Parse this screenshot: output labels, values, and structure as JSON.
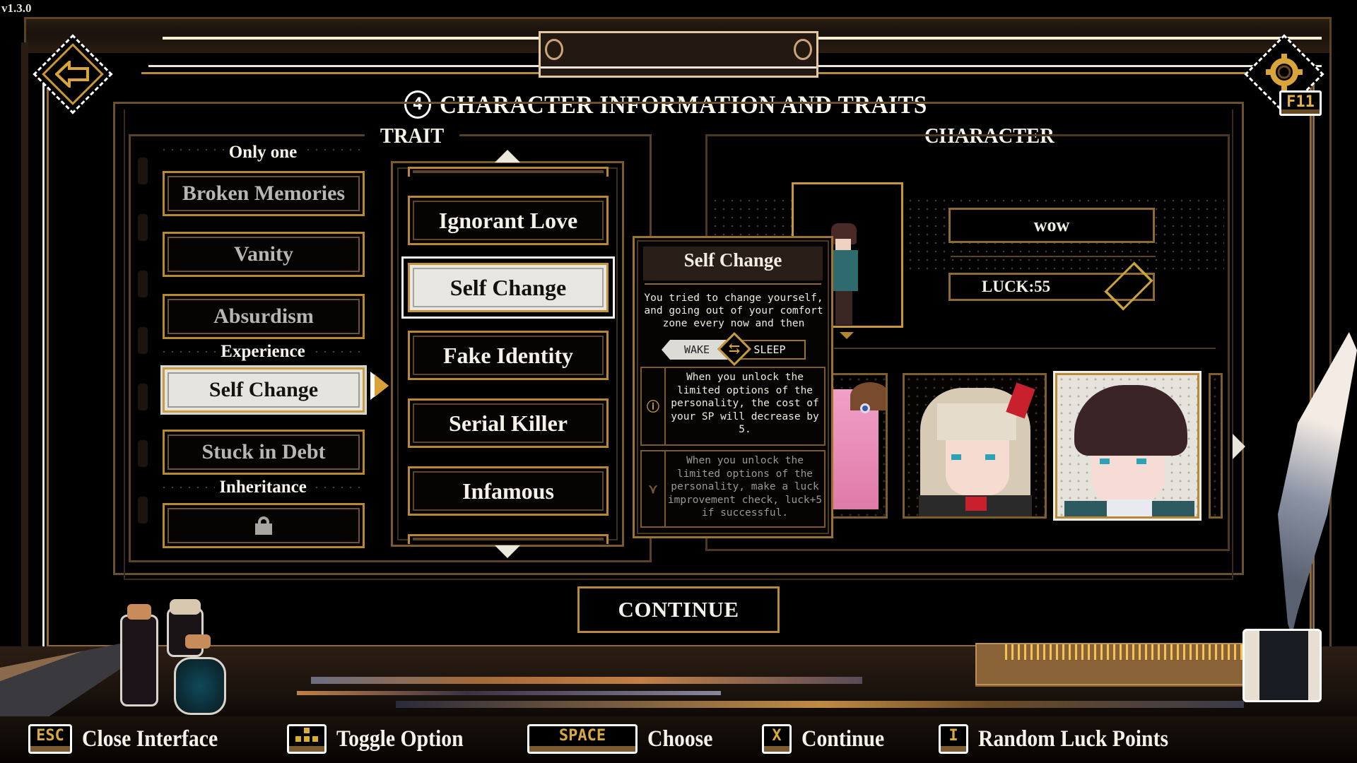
{
  "version": "v1.3.0",
  "header": {
    "step_number": "4",
    "title": "CHARACTER INFORMATION AND TRAITS",
    "back_icon": "back-arrow-icon",
    "settings_icon": "gear-icon",
    "settings_hotkey": "F11"
  },
  "trait": {
    "heading": "TRAIT",
    "categories": [
      {
        "label": "Only one",
        "items": [
          {
            "label": "Broken Memories",
            "state": "available"
          },
          {
            "label": "Vanity",
            "state": "available"
          },
          {
            "label": "Absurdism",
            "state": "available"
          }
        ]
      },
      {
        "label": "Experience",
        "items": [
          {
            "label": "Self Change",
            "state": "selected"
          },
          {
            "label": "Stuck in Debt",
            "state": "available"
          }
        ]
      },
      {
        "label": "Inheritance",
        "items": [
          {
            "label": "",
            "state": "locked",
            "icon": "lock-icon"
          }
        ]
      }
    ],
    "options": [
      {
        "label": "Ignorant Love",
        "selected": false
      },
      {
        "label": "Self Change",
        "selected": true
      },
      {
        "label": "Fake Identity",
        "selected": false
      },
      {
        "label": "Serial Killer",
        "selected": false
      },
      {
        "label": "Infamous",
        "selected": false
      }
    ]
  },
  "tooltip": {
    "title": "Self Change",
    "description": "You tried to change yourself, and going out of your comfort zone every now and then",
    "toggle": {
      "left": "WAKE",
      "right": "SLEEP",
      "active": "WAKE"
    },
    "effects": [
      {
        "icon": "info-circle-icon",
        "text": "When you unlock the limited options of the personality, the cost of your SP will decrease by 5.",
        "active": true
      },
      {
        "icon": "ornament-icon",
        "text": "When you unlock the limited options of the personality, make a luck improvement check, luck+5 if successful.",
        "active": false
      }
    ]
  },
  "character": {
    "heading": "CHARACTER",
    "name": "wow",
    "luck_label": "LUCK:55",
    "luck_value": 55,
    "portraits": [
      {
        "name": "pink-haired-girl",
        "selected": false,
        "partial": true
      },
      {
        "name": "blonde-girl-red-bow",
        "selected": false
      },
      {
        "name": "dark-haired-boy",
        "selected": true
      },
      {
        "name": "next-portrait",
        "selected": false,
        "partial": true
      }
    ]
  },
  "continue_label": "CONTINUE",
  "hints": [
    {
      "key": "ESC",
      "label": "Close Interface"
    },
    {
      "key": "dpad",
      "label": "Toggle Option"
    },
    {
      "key": "SPACE",
      "label": "Choose"
    },
    {
      "key": "X",
      "label": "Continue"
    },
    {
      "key": "I",
      "label": "Random Luck Points"
    }
  ],
  "colors": {
    "gold": "#c9972e",
    "frame_brown": "#5a4226",
    "selected_bg": "#e6e4de",
    "text_light": "#f4f1e8",
    "text_dim": "#b8b6b1"
  }
}
